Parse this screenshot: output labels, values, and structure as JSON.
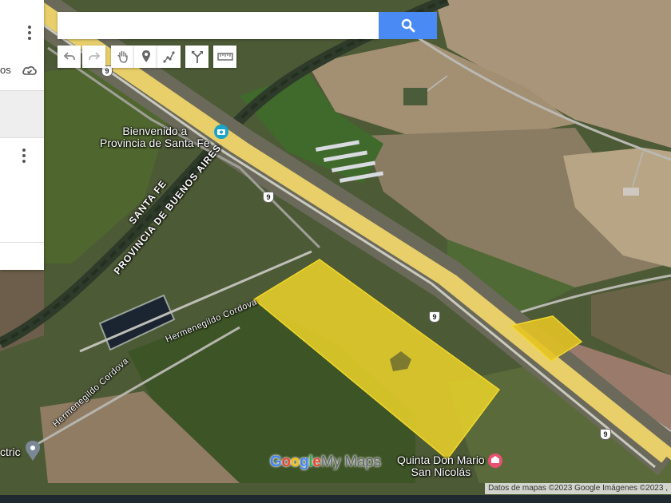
{
  "search": {
    "placeholder": ""
  },
  "toolbar": {
    "tools": [
      {
        "name": "undo",
        "icon": "undo-icon"
      },
      {
        "name": "redo",
        "icon": "redo-icon"
      },
      {
        "name": "pan",
        "icon": "hand-icon"
      },
      {
        "name": "add-marker",
        "icon": "marker-icon"
      },
      {
        "name": "draw-line",
        "icon": "draw-line-icon"
      },
      {
        "name": "directions",
        "icon": "directions-icon"
      },
      {
        "name": "measure",
        "icon": "ruler-icon"
      }
    ]
  },
  "side_panel": {
    "layer_text_fragment": "os"
  },
  "map": {
    "places": {
      "welcome": "Bienvenido a\nProvincia de Santa Fe",
      "quinta": "Quinta Don Mario\nSan Nicolás",
      "electric": "ctric"
    },
    "roads": {
      "cordova_1": "Hermenegildo Cordova",
      "cordova_2": "Hermenegildo Cordova",
      "border_santa_fe": "SANTA FE",
      "border_buenos_aires": "PROVINCIA DE BUENOS AIRES"
    },
    "route_shields": [
      "9",
      "9",
      "9",
      "9"
    ],
    "polygon_color": "#f2d82a"
  },
  "branding": {
    "logo_google": "Google",
    "logo_mymaps": "My Maps",
    "google_colors": [
      "#4285f4",
      "#ea4335",
      "#fbbc05",
      "#4285f4",
      "#34a853",
      "#ea4335"
    ],
    "mymaps_color": "#5f6368"
  },
  "attribution": "Datos de mapas ©2023 Google Imágenes ©2023 ,"
}
